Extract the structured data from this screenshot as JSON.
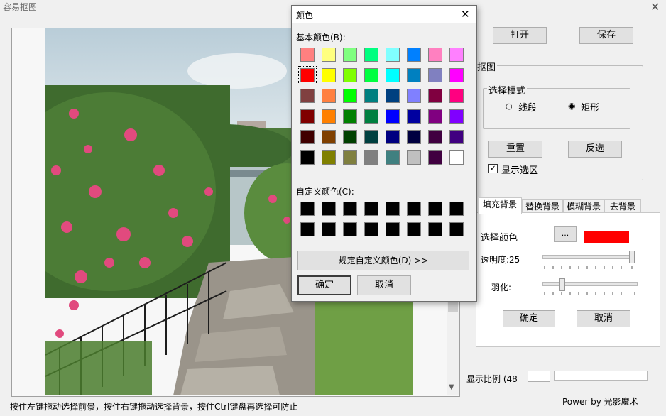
{
  "window": {
    "title": "容易抠图",
    "close_glyph": "✕"
  },
  "toolbar": {
    "open_label": "打开",
    "save_label": "保存"
  },
  "cutout_group": {
    "title": "抠图",
    "mode_group_title": "选择模式",
    "mode_segment": "线段",
    "mode_rect": "矩形",
    "reset_label": "重置",
    "invert_label": "反选",
    "show_selection_label": "显示选区",
    "show_selection_checked": true
  },
  "tabs": [
    "填充背景",
    "替换背景",
    "模糊背景",
    "去背景"
  ],
  "fill_panel": {
    "select_color_label": "选择颜色",
    "color_picker_label": "...",
    "selected_color": "#ff0000",
    "opacity_label": "透明度:25",
    "feather_label": "羽化:",
    "ok_label": "确定",
    "cancel_label": "取消"
  },
  "zoom": {
    "label": "显示比例 (48"
  },
  "status_text": "按住左键拖动选择前景，按住右键拖动选择背景，按住Ctrl键盘再选择可防止",
  "power_text": "Power by 光影魔术",
  "color_dialog": {
    "title": "颜色",
    "close_glyph": "✕",
    "basic_label": "基本颜色(B):",
    "custom_label": "自定义颜色(C):",
    "define_custom_label": "规定自定义颜色(D) >>",
    "ok_label": "确定",
    "cancel_label": "取消",
    "basic_colors": [
      [
        "#ff8080",
        "#ffff80",
        "#80ff80",
        "#00ff80",
        "#80ffff",
        "#0080ff",
        "#ff80c0",
        "#ff80ff"
      ],
      [
        "#ff0000",
        "#ffff00",
        "#80ff00",
        "#00ff40",
        "#00ffff",
        "#0080c0",
        "#8080c0",
        "#ff00ff"
      ],
      [
        "#804040",
        "#ff8040",
        "#00ff00",
        "#008080",
        "#004080",
        "#8080ff",
        "#800040",
        "#ff0080"
      ],
      [
        "#800000",
        "#ff8000",
        "#008000",
        "#008040",
        "#0000ff",
        "#0000a0",
        "#800080",
        "#8000ff"
      ],
      [
        "#400000",
        "#804000",
        "#004000",
        "#004040",
        "#000080",
        "#000040",
        "#400040",
        "#400080"
      ],
      [
        "#000000",
        "#808000",
        "#808040",
        "#808080",
        "#408080",
        "#c0c0c0",
        "#400040",
        "#ffffff"
      ]
    ]
  }
}
